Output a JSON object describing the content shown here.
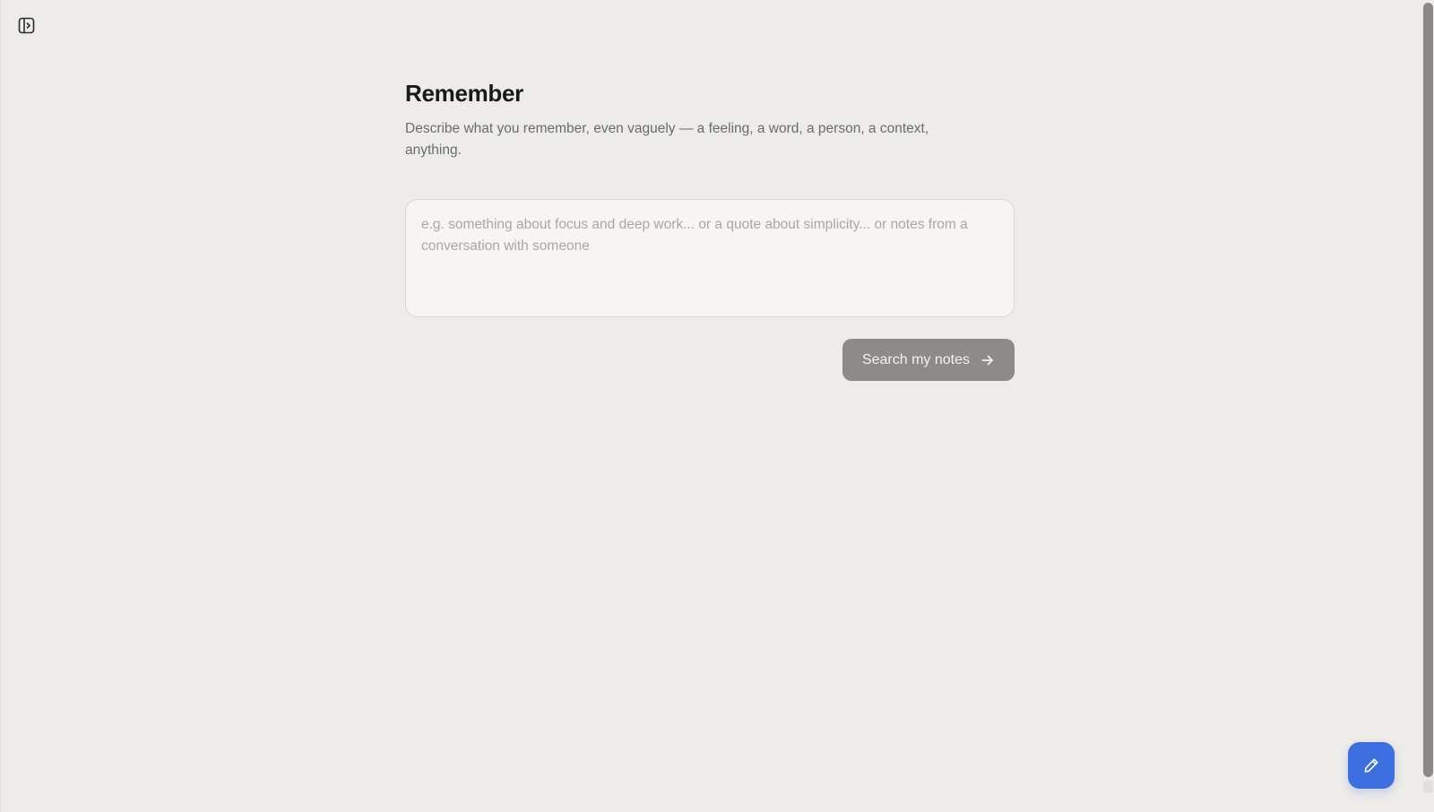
{
  "sidebar": {
    "toggle_icon": "sidebar-expand-icon"
  },
  "main": {
    "title": "Remember",
    "subtitle": "Describe what you remember, even vaguely — a feeling, a word, a person, a context, anything.",
    "input": {
      "value": "",
      "placeholder": "e.g. something about focus and deep work... or a quote about simplicity... or notes from a conversation with someone"
    },
    "search_button": {
      "label": "Search my notes",
      "icon": "arrow-right-icon"
    }
  },
  "fab": {
    "icon": "pencil-icon"
  },
  "colors": {
    "background": "#eeece8",
    "button_disabled": "#8c8b89",
    "accent": "#3d6fe0"
  }
}
